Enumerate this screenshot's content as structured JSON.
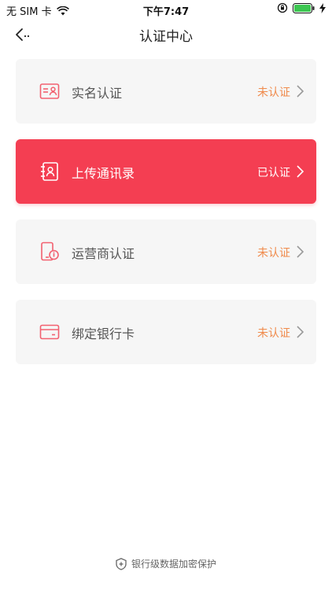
{
  "status_bar": {
    "carrier": "无 SIM 卡",
    "time": "下午7:47"
  },
  "nav": {
    "title": "认证中心"
  },
  "cards": [
    {
      "label": "实名认证",
      "status": "未认证",
      "icon": "id-card-icon"
    },
    {
      "label": "上传通讯录",
      "status": "已认证",
      "icon": "contacts-book-icon"
    },
    {
      "label": "运营商认证",
      "status": "未认证",
      "icon": "phone-lock-icon"
    },
    {
      "label": "绑定银行卡",
      "status": "未认证",
      "icon": "bank-card-icon"
    }
  ],
  "footer": {
    "text": "银行级数据加密保护",
    "icon": "shield-icon"
  },
  "colors": {
    "accent": "#f43e52",
    "pending": "#f08a4b",
    "card_bg": "#f6f6f6"
  }
}
